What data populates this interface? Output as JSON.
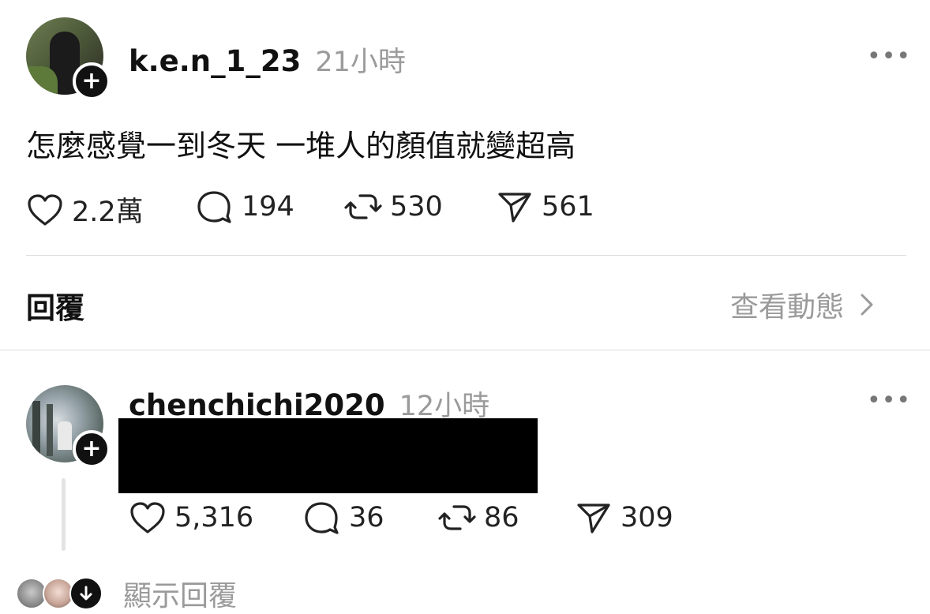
{
  "post": {
    "username": "k.e.n_1_23",
    "time": "21小時",
    "text": "怎麼感覺一到冬天 一堆人的顏值就變超高",
    "likes": "2.2萬",
    "comments": "194",
    "reposts": "530",
    "shares": "561"
  },
  "replies_header": {
    "title": "回覆",
    "view_activity": "查看動態"
  },
  "reply": {
    "username": "chenchichi2020",
    "time": "12小時",
    "likes": "5,316",
    "comments": "36",
    "reposts": "86",
    "shares": "309"
  },
  "show_replies": "顯示回覆",
  "icons": {
    "more": "more-dots-icon",
    "follow": "plus-icon",
    "like": "heart-icon",
    "comment": "comment-icon",
    "repost": "repost-icon",
    "share": "send-icon",
    "chevron": "chevron-right-icon",
    "expand": "arrow-down-icon"
  }
}
